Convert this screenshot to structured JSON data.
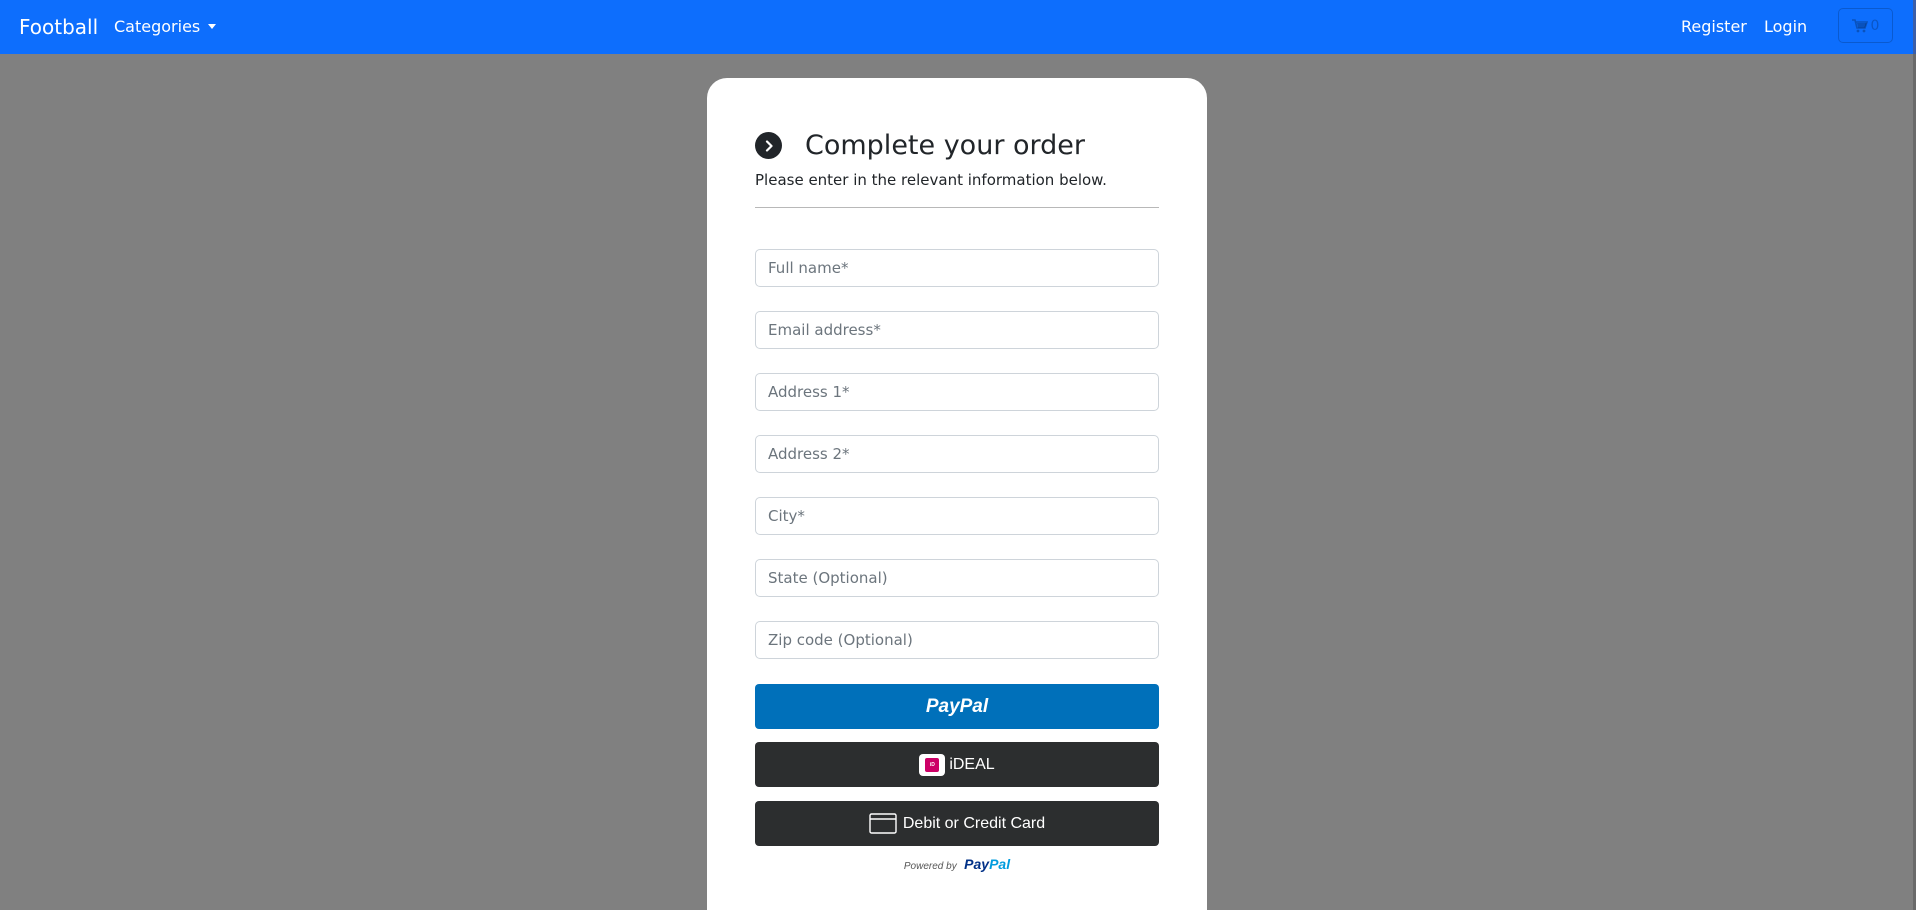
{
  "colors": {
    "accent": "#0d6efd",
    "backdrop": "#808080",
    "paypal_blue": "#0070ba",
    "dark_button": "#2c2e2f"
  },
  "navbar": {
    "brand": "Football",
    "categories_label": "Categories",
    "register_label": "Register",
    "login_label": "Login",
    "cart_count": "0",
    "cart_icon": "cart-icon"
  },
  "checkout": {
    "icon": "chevron-right-circle-icon",
    "title": "Complete your order",
    "subtitle": "Please enter in the relevant information below.",
    "fields": {
      "full_name": {
        "placeholder": "Full name*",
        "value": ""
      },
      "email": {
        "placeholder": "Email address*",
        "value": ""
      },
      "address1": {
        "placeholder": "Address 1*",
        "value": ""
      },
      "address2": {
        "placeholder": "Address 2*",
        "value": ""
      },
      "city": {
        "placeholder": "City*",
        "value": ""
      },
      "state": {
        "placeholder": "State (Optional)",
        "value": ""
      },
      "zip": {
        "placeholder": "Zip code (Optional)",
        "value": ""
      }
    },
    "payment": {
      "paypal_label": "PayPal",
      "ideal_label": "iDEAL",
      "card_label": "Debit or Credit Card",
      "powered_by": "Powered by",
      "powered_brand_pay": "Pay",
      "powered_brand_pal": "Pal"
    }
  }
}
